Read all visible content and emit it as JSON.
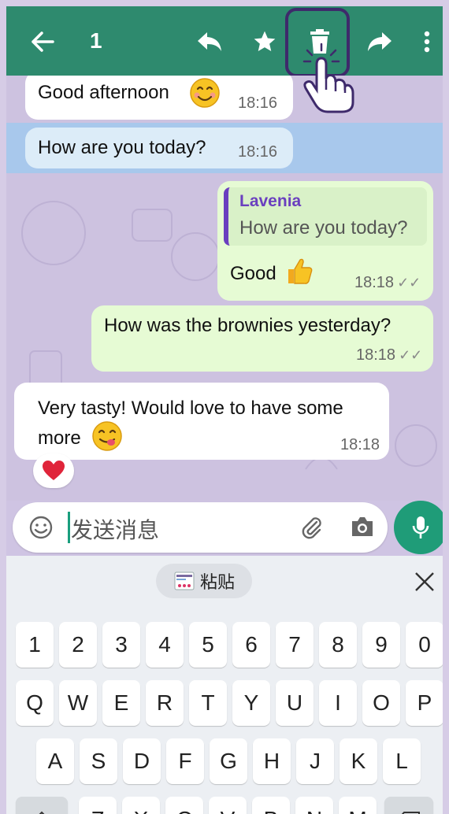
{
  "topbar": {
    "selected_count": "1",
    "icons": [
      "back-arrow-icon",
      "reply-icon",
      "star-icon",
      "delete-icon",
      "forward-icon",
      "more-vert-icon"
    ]
  },
  "messages": [
    {
      "id": "m1",
      "direction": "in",
      "text": "Good afternoon",
      "emoji": "smiling-face",
      "time": "18:16"
    },
    {
      "id": "m2",
      "direction": "in",
      "text": "How are you today?",
      "time": "18:16",
      "selected": true
    },
    {
      "id": "m3",
      "direction": "out",
      "quote_author": "Lavenia",
      "quote_text": "How are you today?",
      "text": "Good",
      "emoji": "thumbs-up",
      "time": "18:18"
    },
    {
      "id": "m4",
      "direction": "out",
      "text": "How was the brownies yesterday?",
      "time": "18:18"
    },
    {
      "id": "m5",
      "direction": "in",
      "text": "Very tasty! Would love to have some more",
      "emoji": "yum-face",
      "time": "18:18",
      "reaction": "red-heart"
    }
  ],
  "composer": {
    "placeholder": "发送消息"
  },
  "keyboard": {
    "paste_label": "粘贴",
    "row_numbers": [
      "1",
      "2",
      "3",
      "4",
      "5",
      "6",
      "7",
      "8",
      "9",
      "0"
    ],
    "row1": [
      "Q",
      "W",
      "E",
      "R",
      "T",
      "Y",
      "U",
      "I",
      "O",
      "P"
    ],
    "row2": [
      "A",
      "S",
      "D",
      "F",
      "G",
      "H",
      "J",
      "K",
      "L"
    ],
    "row3": [
      "Z",
      "X",
      "C",
      "V",
      "B",
      "N",
      "M"
    ]
  },
  "colors": {
    "header": "#2e8a6e",
    "outgoing_bubble": "#e6fbd4",
    "selection": "#a8c8ec",
    "mic_button": "#1f9c78",
    "highlight": "#3e2a6b"
  }
}
